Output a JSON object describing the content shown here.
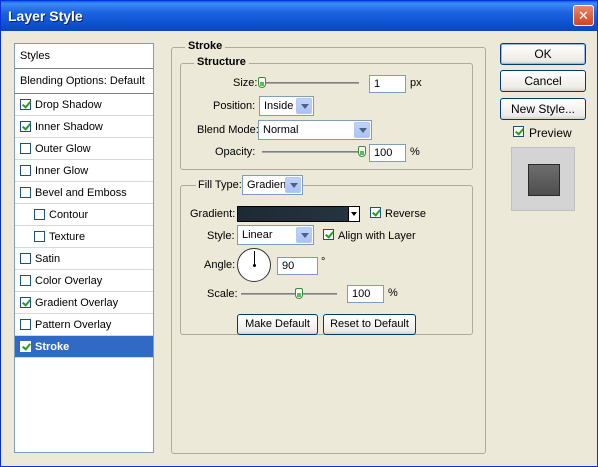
{
  "window": {
    "title": "Layer Style",
    "close_glyph": "✕"
  },
  "styles_list": {
    "header": "Styles",
    "blending": "Blending Options: Default",
    "items": [
      {
        "label": "Drop Shadow",
        "checked": true
      },
      {
        "label": "Inner Shadow",
        "checked": true
      },
      {
        "label": "Outer Glow",
        "checked": false
      },
      {
        "label": "Inner Glow",
        "checked": false
      },
      {
        "label": "Bevel and Emboss",
        "checked": false
      },
      {
        "label": "Contour",
        "checked": false
      },
      {
        "label": "Texture",
        "checked": false
      },
      {
        "label": "Satin",
        "checked": false
      },
      {
        "label": "Color Overlay",
        "checked": false
      },
      {
        "label": "Gradient Overlay",
        "checked": true
      },
      {
        "label": "Pattern Overlay",
        "checked": false
      },
      {
        "label": "Stroke",
        "checked": true
      }
    ]
  },
  "stroke": {
    "title": "Stroke",
    "structure": {
      "title": "Structure",
      "size_label": "Size:",
      "size_value": "1",
      "size_unit": "px",
      "size_level": 0.0,
      "position_label": "Position:",
      "position_value": "Inside",
      "blend_label": "Blend Mode:",
      "blend_value": "Normal",
      "opacity_label": "Opacity:",
      "opacity_value": "100",
      "opacity_unit": "%",
      "opacity_level": 1.0
    },
    "fill": {
      "fill_type_label": "Fill Type:",
      "fill_type_value": "Gradient",
      "gradient_label": "Gradient:",
      "reverse_label": "Reverse",
      "reverse_checked": true,
      "style_label": "Style:",
      "style_value": "Linear",
      "align_label": "Align with Layer",
      "align_checked": true,
      "angle_label": "Angle:",
      "angle_value": "90",
      "angle_unit": "°",
      "scale_label": "Scale:",
      "scale_value": "100",
      "scale_unit": "%",
      "scale_level": 0.6
    },
    "make_default": "Make Default",
    "reset_default": "Reset to Default"
  },
  "actions": {
    "ok": "OK",
    "cancel": "Cancel",
    "new_style": "New Style...",
    "preview_label": "Preview",
    "preview_checked": true
  },
  "colors": {
    "title_blue": "#0a5fe6",
    "selected": "#316ac5",
    "gradient_dark": "#1c2a33",
    "preview_swatch": "#5e5e5e"
  }
}
